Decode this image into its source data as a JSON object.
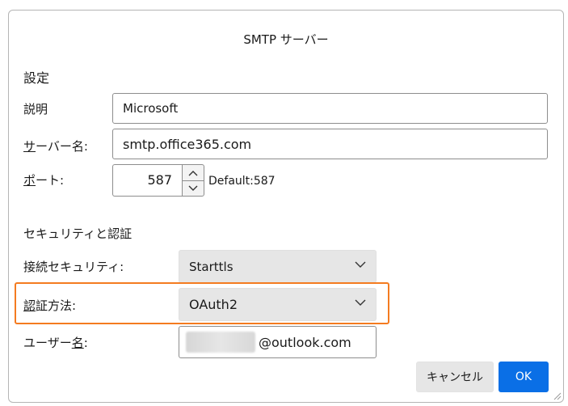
{
  "dialog": {
    "title": "SMTP サーバー"
  },
  "settings": {
    "section_label": "設定",
    "description_label": "説明",
    "description_value": "Microsoft",
    "server_label_underlined": "サ",
    "server_label_rest": "ーバー名:",
    "server_value": "smtp.office365.com",
    "port_label_underlined": "ポ",
    "port_label_rest": "ート:",
    "port_value": "587",
    "port_default": "Default:587"
  },
  "security": {
    "section_label": "セキュリティと認証",
    "connection_label": "接続セキュリティ:",
    "connection_value": "Starttls",
    "auth_label_underlined": "認",
    "auth_label_rest": "証方法:",
    "auth_value": "OAuth2",
    "username_label_pre": "ユーザー",
    "username_label_underlined": "名",
    "username_label_post": ":",
    "username_suffix": "@outlook.com"
  },
  "buttons": {
    "cancel": "キャンセル",
    "ok": "OK"
  },
  "colors": {
    "highlight": "#f47b20",
    "ok_button": "#0a6fe6",
    "dropdown_bg": "#e6e6e6"
  },
  "icons": [
    "chevron-up-icon",
    "chevron-down-icon",
    "resize-grip-icon"
  ]
}
